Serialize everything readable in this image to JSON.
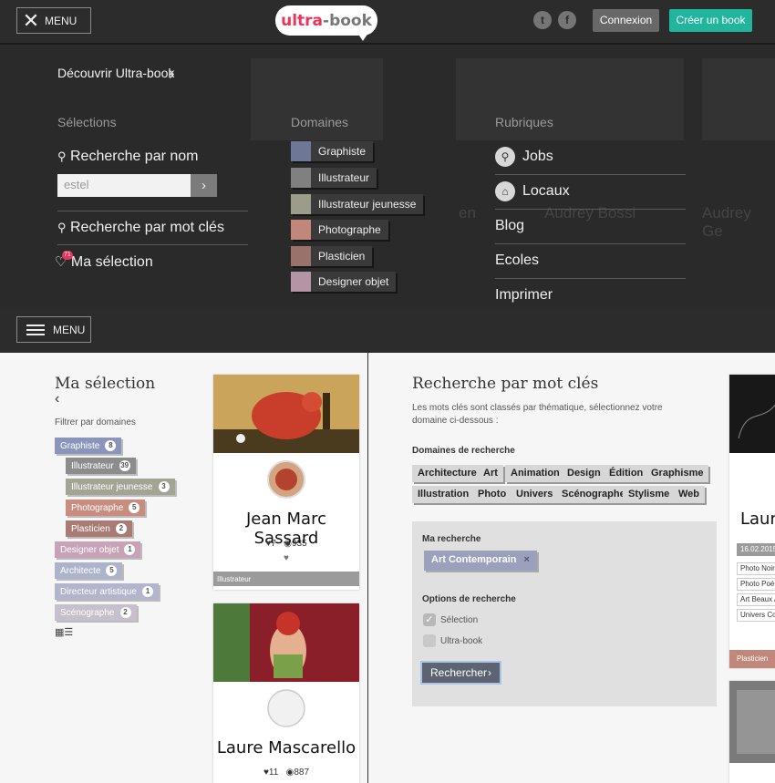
{
  "header": {
    "menu_label": "MENU",
    "logo_part1": "ultra",
    "logo_part2": "-book",
    "twitter_icon": "twitter-icon",
    "facebook_icon": "facebook-icon",
    "connexion": "Connexion",
    "creer": "Créer un book",
    "accent_color": "#22b59d",
    "brand_color": "#e8355a"
  },
  "overlay": {
    "decouvrir": "Découvrir Ultra-book",
    "col_selections": "Sélections",
    "col_domaines": "Domaines",
    "col_rubriques": "Rubriques",
    "recherche_nom": "Recherche par nom",
    "search_value": "estel",
    "recherche_mot": "Recherche par mot clés",
    "ma_selection": "Ma sélection",
    "badge": "71",
    "domaines": [
      {
        "label": "Graphiste",
        "color": "#6f7797"
      },
      {
        "label": "Illustrateur",
        "color": "#808080"
      },
      {
        "label": "Illustrateur jeunesse",
        "color": "#9b9c8c"
      },
      {
        "label": "Photographe",
        "color": "#c0877a"
      },
      {
        "label": "Plasticien",
        "color": "#9b716c"
      },
      {
        "label": "Designer objet",
        "color": "#b494a6"
      }
    ],
    "rubriques": [
      "Jobs",
      "Locaux",
      "Blog",
      "Ecoles",
      "Imprimer"
    ],
    "ghost_names": [
      "en",
      "Audrey Bossi",
      "Audrey Ge"
    ]
  },
  "bar2": {
    "menu_label": "MENU"
  },
  "left": {
    "title": "Ma sélection",
    "back": "‹",
    "filter_label": "Filtrer par domaines",
    "filters": [
      {
        "label": "Graphiste",
        "count": "8",
        "color": "#8b94ba"
      },
      {
        "label": "Illustrateur",
        "count": "39",
        "color": "#8c8c8c"
      },
      {
        "label": "Illustrateur jeunesse",
        "count": "3",
        "color": "#a3a494"
      },
      {
        "label": "Photographe",
        "count": "5",
        "color": "#c98d80"
      },
      {
        "label": "Plasticien",
        "count": "2",
        "color": "#a87b75"
      },
      {
        "label": "Designer objet",
        "count": "1",
        "color": "#c8a3b7"
      },
      {
        "label": "Architecte",
        "count": "5",
        "color": "#aeb3cc"
      },
      {
        "label": "Directeur artistique",
        "count": "1",
        "color": "#b2b5cc"
      },
      {
        "label": "Scénographe",
        "count": "2",
        "color": "#c6c0cc"
      }
    ],
    "cards": [
      {
        "name": "Jean Marc Sassard",
        "likes": "7",
        "views": "935",
        "domain": "Illustrateur"
      },
      {
        "name": "Laure Mascarello",
        "likes": "11",
        "views": "887",
        "domain": ""
      }
    ]
  },
  "right": {
    "title": "Recherche par mot clés",
    "desc": "Les mots clés sont classés par thématique, sélectionnez votre domaine ci-dessous :",
    "domains_label": "Domaines de recherche",
    "keywords_row1": [
      "Architecture",
      "Art",
      "Animation",
      "Design",
      "Édition",
      "Graphisme"
    ],
    "keywords_row2": [
      "Illustration",
      "Photo",
      "Univers",
      "Scénographe",
      "Stylisme",
      "Web"
    ],
    "ma_recherche": "Ma recherche",
    "chip": "Art Contemporain",
    "chip_close": "×",
    "options": "Options de recherche",
    "opt1": "Sélection",
    "opt2": "Ultra-book",
    "btn": "Rechercher",
    "side_card": {
      "name": "Laur",
      "date": "16.02.2015",
      "lines": [
        "Photo Noir",
        "Photo Poé",
        "Art Beaux A",
        "Univers Co"
      ],
      "domain": "Plasticien"
    }
  }
}
